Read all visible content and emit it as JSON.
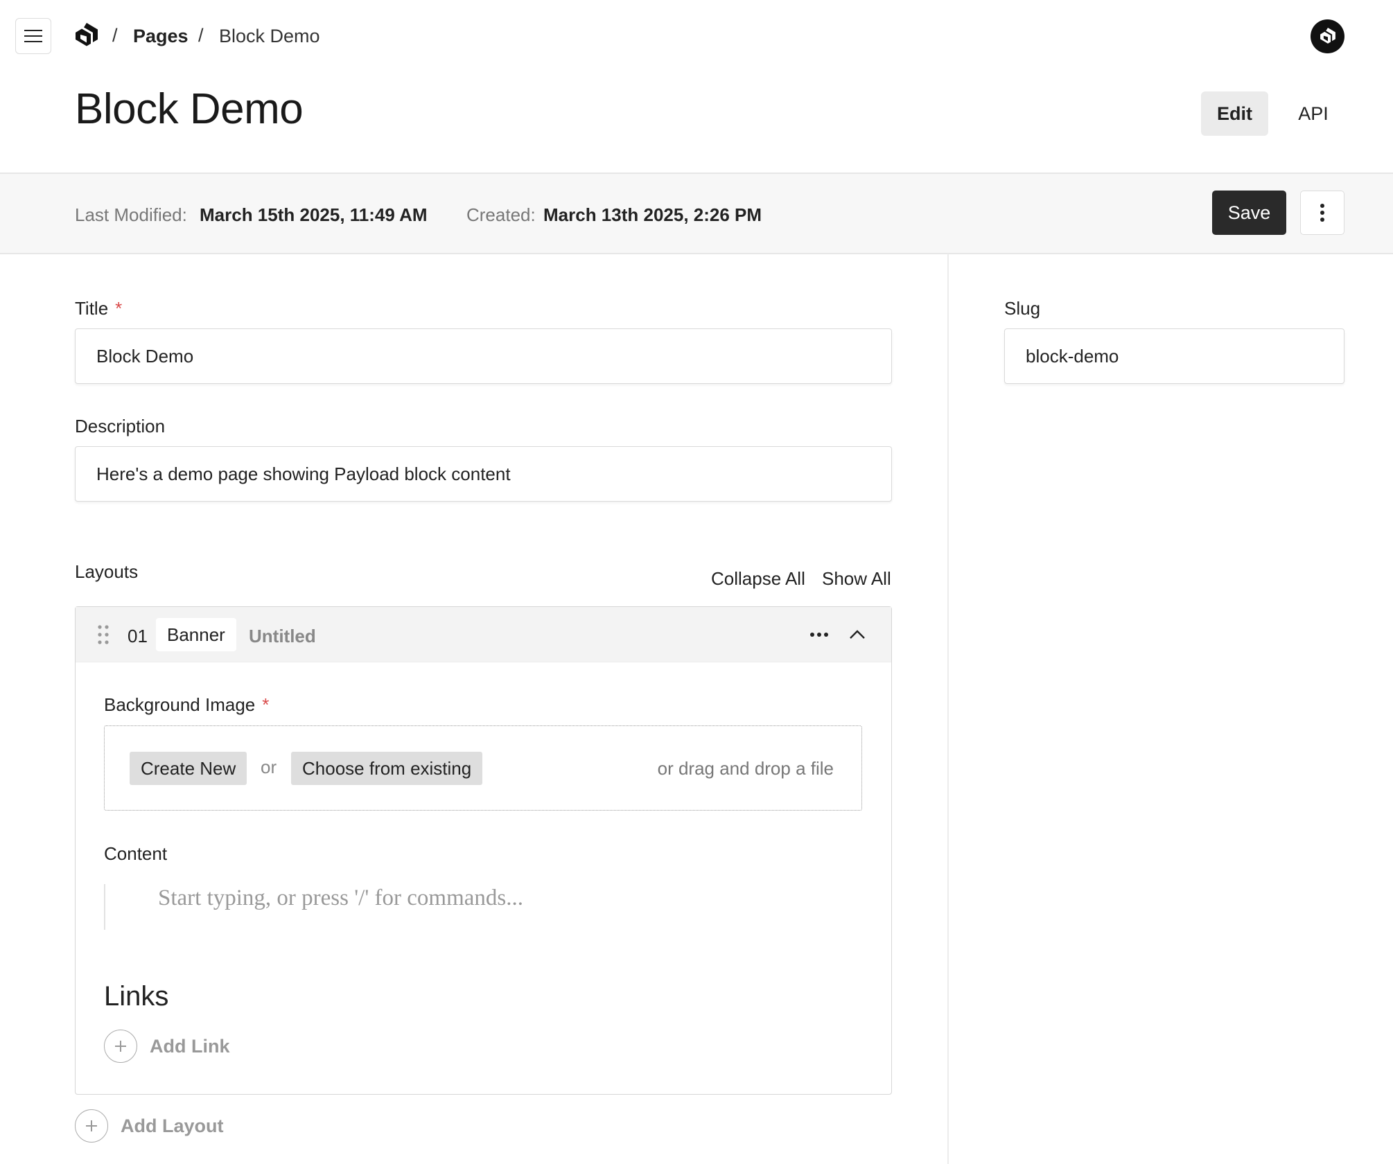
{
  "nav": {
    "breadcrumb": [
      {
        "label": "/"
      },
      {
        "label": "Pages"
      },
      {
        "label": "/"
      },
      {
        "label": "Block Demo"
      }
    ]
  },
  "icons": {
    "menu": "hamburger-menu-icon",
    "logo": "payload-logo-icon",
    "avatar": "user-avatar-icon",
    "more": "vertical-dots-icon",
    "drag": "drag-handle-icon",
    "block_more": "horizontal-dots-icon",
    "collapse": "chevron-up-icon",
    "add": "plus-circle-icon"
  },
  "header": {
    "title": "Block Demo",
    "tabs": [
      {
        "label": "Edit",
        "active": true
      },
      {
        "label": "API",
        "active": false
      }
    ]
  },
  "meta": {
    "last_modified_label": "Last Modified:",
    "last_modified_value": "March 15th 2025, 11:49 AM",
    "created_label": "Created:",
    "created_value": "March 13th 2025, 2:26 PM",
    "save_label": "Save"
  },
  "fields": {
    "title": {
      "label": "Title",
      "required_mark": "*",
      "value": "Block Demo"
    },
    "description": {
      "label": "Description",
      "value": "Here's a demo page showing Payload block content"
    },
    "slug": {
      "label": "Slug",
      "value": "block-demo"
    }
  },
  "layouts": {
    "label": "Layouts",
    "collapse_all": "Collapse All",
    "show_all": "Show All",
    "blocks": [
      {
        "number": "01",
        "type": "Banner",
        "title": "Untitled",
        "background_image": {
          "label": "Background Image",
          "required_mark": "*",
          "create_new": "Create New",
          "or": "or",
          "choose_existing": "Choose from existing",
          "drag_drop": "or drag and drop a file"
        },
        "content": {
          "label": "Content",
          "placeholder": "Start typing, or press '/' for commands..."
        },
        "links": {
          "heading": "Links",
          "add_label": "Add Link"
        }
      }
    ],
    "add_layout_label": "Add Layout"
  },
  "colors": {
    "accent_dark": "#2a2a2a",
    "required": "#d94a4a",
    "meta_bg": "#f7f7f7"
  }
}
